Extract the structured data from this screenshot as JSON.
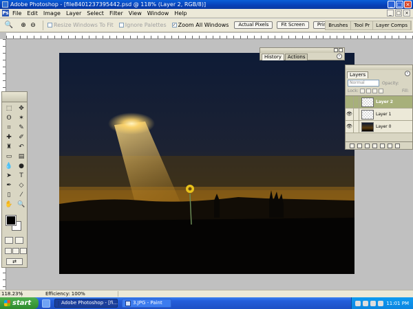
{
  "window": {
    "title": "Adobe Photoshop - [file8401237395442.psd @ 118% (Layer 2, RGB/8)]"
  },
  "menu": [
    "File",
    "Edit",
    "Image",
    "Layer",
    "Select",
    "Filter",
    "View",
    "Window",
    "Help"
  ],
  "options": {
    "resize_windows": "Resize Windows To Fit",
    "ignore_palettes": "Ignore Palettes",
    "zoom_all_windows": "Zoom All Windows",
    "actual_pixels": "Actual Pixels",
    "fit_screen": "Fit Screen",
    "print_size": "Print Size"
  },
  "palette_well": [
    "Brushes",
    "Tool Pr",
    "Layer Comps"
  ],
  "history_panel": {
    "tabs": [
      "History",
      "Actions"
    ]
  },
  "layers_panel": {
    "tab": "Layers",
    "blend_mode": "Normal",
    "opacity_label": "Opacity:",
    "lock_label": "Lock:",
    "fill_label": "Fill:",
    "layers": [
      {
        "name": "Layer 2",
        "selected": true,
        "visible": false
      },
      {
        "name": "Layer 1",
        "selected": false,
        "visible": true
      },
      {
        "name": "Layer 0",
        "selected": false,
        "visible": true
      }
    ]
  },
  "status": {
    "zoom": "118.23%",
    "doc_info": "Efficiency: 100%"
  },
  "taskbar": {
    "start": "start",
    "tasks": [
      "Adobe Photoshop - [fi...",
      "3.JPG - Paint"
    ],
    "clock": "11:01 PM"
  },
  "colors": {
    "title_bar": "#0a5fd8",
    "selected_layer": "#a7b07a",
    "canvas_sky": "#0d1a33",
    "sun_glow": "#ffd56a"
  }
}
